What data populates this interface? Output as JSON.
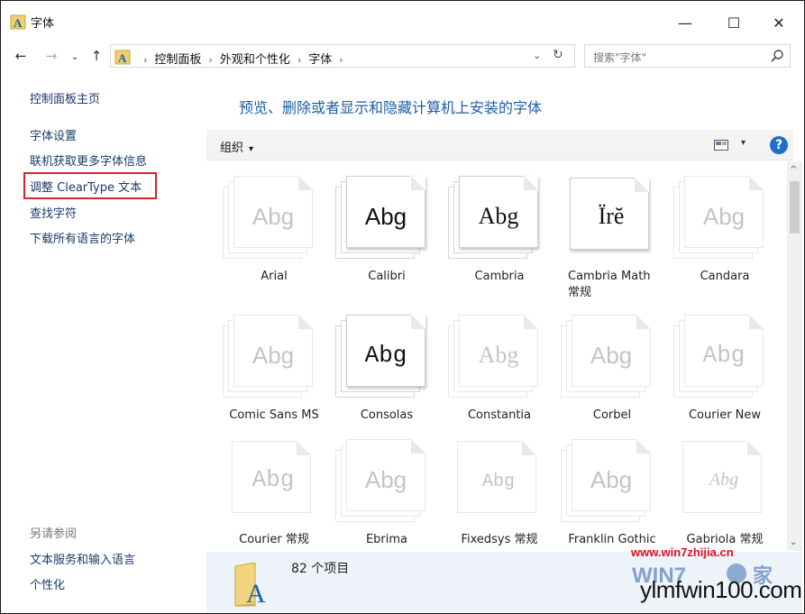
{
  "window": {
    "title": "字体",
    "minimize_glyph": "—",
    "maximize_glyph": "☐",
    "close_glyph": "✕"
  },
  "nav": {
    "back_glyph": "←",
    "forward_glyph": "→",
    "history_glyph": "⌄",
    "up_glyph": "↑",
    "breadcrumbs": [
      "控制面板",
      "外观和个性化",
      "字体"
    ],
    "separator": "›",
    "dropdown_glyph": "⌄",
    "refresh_glyph": "↻",
    "search_placeholder": "搜索\"字体\""
  },
  "sidebar": {
    "home": "控制面板主页",
    "links": [
      "字体设置",
      "联机获取更多字体信息",
      "调整 ClearType 文本",
      "查找字符",
      "下载所有语言的字体"
    ],
    "see_also_title": "另请参阅",
    "see_also": [
      "文本服务和输入语言",
      "个性化"
    ]
  },
  "main": {
    "heading": "预览、删除或者显示和隐藏计算机上安装的字体"
  },
  "toolbar": {
    "organize": "组织",
    "dropdown_glyph": "▾",
    "help": "?"
  },
  "fonts": [
    {
      "name": "Arial",
      "sample": "Abg",
      "style": "faded"
    },
    {
      "name": "Calibri",
      "sample": "Abg",
      "style": "dark"
    },
    {
      "name": "Cambria",
      "sample": "Abg",
      "style": "dark"
    },
    {
      "name": "Cambria Math",
      "subtitle": "常规",
      "sample": "Ïrĕ",
      "style": "dark-single"
    },
    {
      "name": "Candara",
      "sample": "Abg",
      "style": "faded"
    },
    {
      "name": "Comic Sans MS",
      "sample": "Abg",
      "style": "faded"
    },
    {
      "name": "Consolas",
      "sample": "Abg",
      "style": "dark"
    },
    {
      "name": "Constantia",
      "sample": "Abg",
      "style": "faded"
    },
    {
      "name": "Corbel",
      "sample": "Abg",
      "style": "faded"
    },
    {
      "name": "Courier New",
      "sample": "Abg",
      "style": "faded"
    },
    {
      "name": "Courier 常规",
      "sample": "Abg",
      "style": "faded-single"
    },
    {
      "name": "Ebrima",
      "sample": "Abg",
      "style": "faded"
    },
    {
      "name": "Fixedsys 常规",
      "sample": "Abg",
      "style": "faded-single"
    },
    {
      "name": "Franklin Gothic",
      "sample": "Abg",
      "style": "faded"
    },
    {
      "name": "Gabriola 常规",
      "sample": "Abg",
      "style": "faded-single"
    }
  ],
  "scrollbar": {
    "up_glyph": "^",
    "down_glyph": "⌄"
  },
  "details": {
    "item_count": "82 个项目"
  },
  "watermark": {
    "site": "www.win7zhijia.cn",
    "brand": "ylmfwin100.com"
  },
  "colors": {
    "accent_blue": "#1d5fa8",
    "link": "#1a3a6b",
    "highlight_red": "#d9232e",
    "toolbar_bg": "#f3f3f3",
    "details_bg": "#eef3fa",
    "folder_yellow": "#e9c46a"
  }
}
